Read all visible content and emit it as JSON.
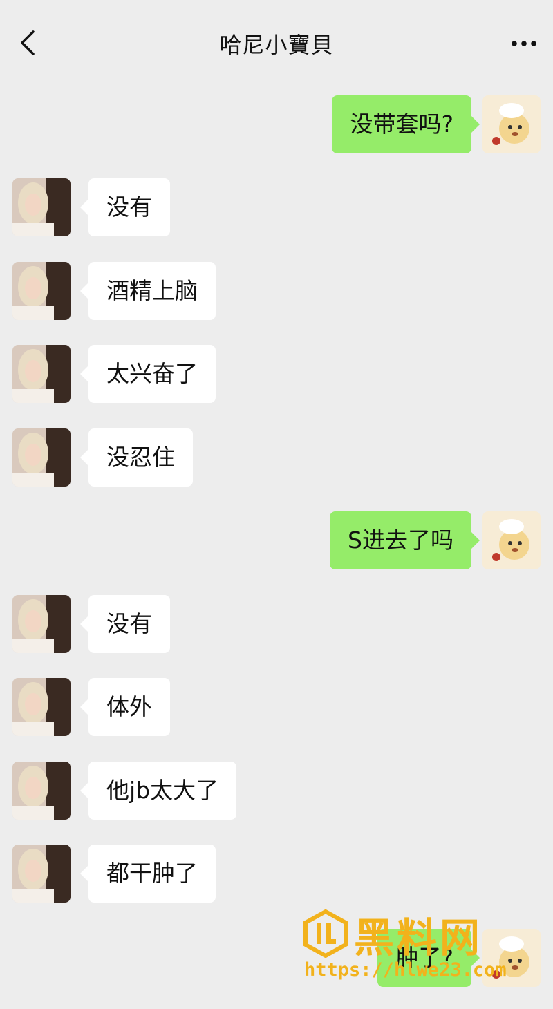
{
  "header": {
    "title": "哈尼小寶貝",
    "back_icon": "chevron-left-icon",
    "more_icon": "more-icon"
  },
  "messages": [
    {
      "side": "out",
      "text": "没带套吗?"
    },
    {
      "side": "in",
      "text": "没有"
    },
    {
      "side": "in",
      "text": "酒精上脑"
    },
    {
      "side": "in",
      "text": "太兴奋了"
    },
    {
      "side": "in",
      "text": "没忍住"
    },
    {
      "side": "out",
      "text": "S进去了吗"
    },
    {
      "side": "in",
      "text": "没有"
    },
    {
      "side": "in",
      "text": "体外"
    },
    {
      "side": "in",
      "text": "他jb太大了"
    },
    {
      "side": "in",
      "text": "都干肿了"
    },
    {
      "side": "out",
      "text": "肿了?"
    }
  ],
  "watermark": {
    "brand": "黑料网",
    "url": "https://hlwe23.com"
  },
  "colors": {
    "background": "#ededed",
    "incoming": "#ffffff",
    "outgoing": "#95ec69",
    "watermark": "#f2b21c"
  }
}
